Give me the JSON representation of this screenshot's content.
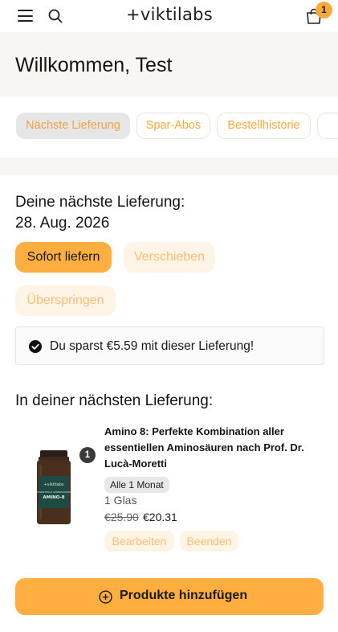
{
  "header": {
    "logo_text": "+viktilabs",
    "cart_count": "1",
    "icons": [
      "menu-icon",
      "search-icon",
      "shopping-bag-icon"
    ]
  },
  "welcome": {
    "title": "Willkommen, Test"
  },
  "tabs": [
    {
      "label": "Nächste Lieferung",
      "active": true
    },
    {
      "label": "Spar-Abos",
      "active": false
    },
    {
      "label": "Bestellhistorie",
      "active": false
    },
    {
      "label": "",
      "active": false
    }
  ],
  "next_delivery": {
    "heading": "Deine nächste Lieferung:",
    "date": "28. Aug. 2026",
    "deliver_now_label": "Sofort liefern",
    "postpone_label": "Verschieben",
    "skip_label": "Überspringen",
    "savings_text": "Du sparst €5.59 mit dieser Lieferung!"
  },
  "items_section": {
    "heading": "In deiner nächsten Lieferung:",
    "items": [
      {
        "name": "Amino 8: Perfekte Kombination aller essentiellen Aminosäuren nach Prof. Dr. Lucà-Moretti",
        "quantity": "1",
        "interval": "Alle 1 Monat",
        "unit": "1 Glas",
        "price_old": "€25.90",
        "price_new": "€20.31",
        "edit_label": "Bearbeiten",
        "end_label": "Beenden",
        "label_brand": "+viktilabs",
        "label_sub": "ESSENTIELLE AMINOSÄUREN",
        "label_product": "AMINO-8"
      }
    ]
  },
  "add_products_label": "Produkte hinzufügen",
  "colors": {
    "accent": "#ffae3f",
    "soft": "#fff4e6",
    "soft_text": "#ffbd73",
    "band": "#f8f6f0"
  }
}
